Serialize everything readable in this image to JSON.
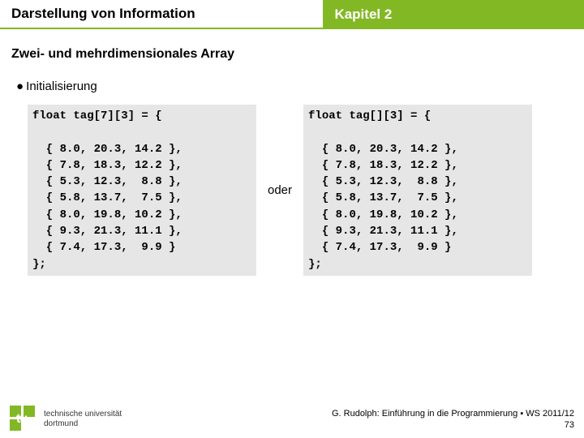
{
  "header": {
    "left": "Darstellung von Information",
    "right": "Kapitel 2"
  },
  "subtitle": "Zwei- und mehrdimensionales Array",
  "bullet": "Initialisierung",
  "code_left": "float tag[7][3] = {\n\n  { 8.0, 20.3, 14.2 },\n  { 7.8, 18.3, 12.2 },\n  { 5.3, 12.3,  8.8 },\n  { 5.8, 13.7,  7.5 },\n  { 8.0, 19.8, 10.2 },\n  { 9.3, 21.3, 11.1 },\n  { 7.4, 17.3,  9.9 }\n};",
  "oder": "oder",
  "code_right": "float tag[][3] = {\n\n  { 8.0, 20.3, 14.2 },\n  { 7.8, 18.3, 12.2 },\n  { 5.3, 12.3,  8.8 },\n  { 5.8, 13.7,  7.5 },\n  { 8.0, 19.8, 10.2 },\n  { 9.3, 21.3, 11.1 },\n  { 7.4, 17.3,  9.9 }\n};",
  "logo": {
    "tu": "tu",
    "name_line1": "technische universität",
    "name_line2": "dortmund"
  },
  "credits": {
    "line1": "G. Rudolph: Einführung in die Programmierung ▪ WS 2011/12",
    "line2": "73"
  }
}
